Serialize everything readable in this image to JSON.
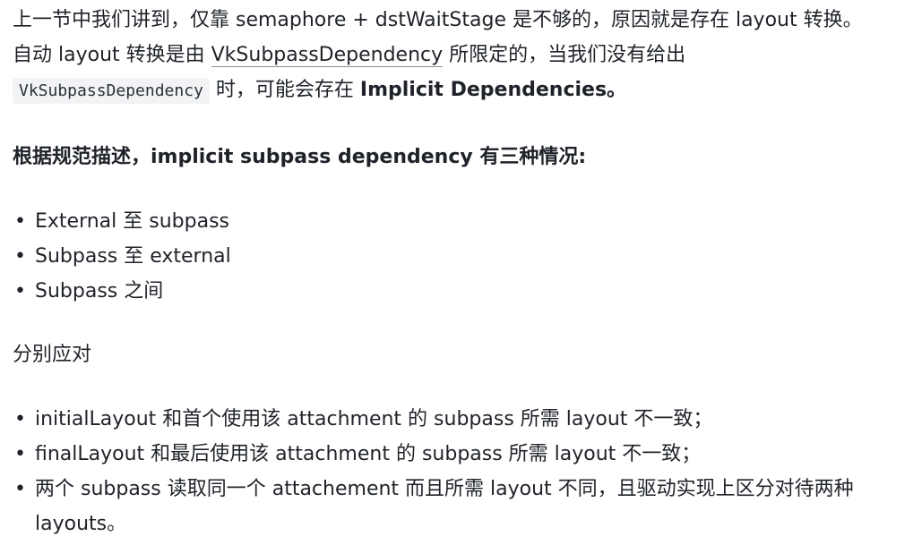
{
  "intro": {
    "line1": "上一节中我们讲到，仅靠 semaphore + dstWaitStage 是不够的，原因就是存在 layout 转换。",
    "line2_pre": "自动 layout 转换是由 ",
    "line2_link": "VkSubpassDependency",
    "line2_post": " 所限定的，当我们没有给出",
    "line3_code": "VkSubpassDependency",
    "line3_mid": " 时，可能会存在 ",
    "line3_bold": "Implicit Dependencies",
    "line3_end": "。"
  },
  "heading": "根据规范描述，implicit subpass dependency 有三种情况:",
  "cases": [
    "External 至 subpass",
    "Subpass 至 external",
    "Subpass 之间"
  ],
  "lead": "分别应对",
  "details": [
    "initialLayout 和首个使用该 attachment 的 subpass 所需 layout 不一致；",
    "finalLayout 和最后使用该 attachment 的 subpass 所需 layout 不一致；",
    "两个 subpass 读取同一个 attachement 而且所需 layout 不同，且驱动实现上区分对待两种 layouts。"
  ]
}
